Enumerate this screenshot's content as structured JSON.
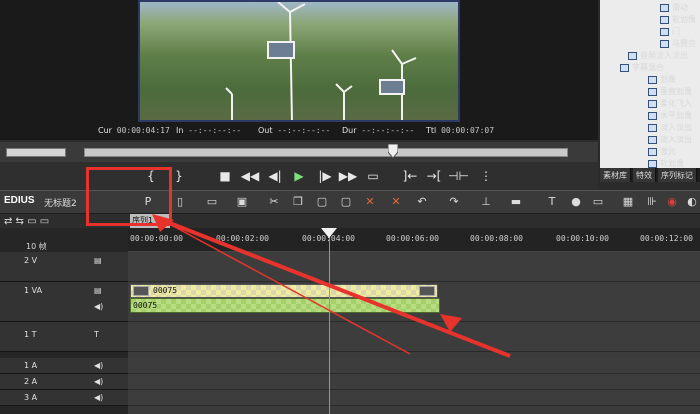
{
  "monitor": {
    "timecodes": [
      {
        "label": "Cur",
        "value": "00:00:04:17"
      },
      {
        "label": "In",
        "value": "--:--:--:--"
      },
      {
        "label": "Out",
        "value": "--:--:--:--"
      },
      {
        "label": "Dur",
        "value": "--:--:--:--"
      },
      {
        "label": "Ttl",
        "value": "00:00:07:07"
      }
    ]
  },
  "bin": {
    "items": [
      "滑动",
      "软划像",
      "门",
      "马赛克",
      "音频淡入淡出",
      "字幕混合",
      "划像",
      "垂直划像",
      "柔化飞入",
      "水平划像",
      "淡入淡出",
      "淡入淡出",
      "激光",
      "软划像"
    ],
    "tabs": [
      "素材库",
      "特效",
      "序列标记"
    ]
  },
  "toolbar": {
    "logo": "EDIUS",
    "project": "无标题2"
  },
  "timeline": {
    "sequence_tab": "序列1",
    "scale_label": "10 帧",
    "ruler": [
      "00:00:00:00",
      "00:00:02:00",
      "00:00:04:00",
      "00:00:06:00",
      "00:00:08:00",
      "00:00:10:00",
      "00:00:12:00"
    ],
    "tracks": [
      {
        "name": "2 V",
        "type": "video"
      },
      {
        "name": "1 VA",
        "type": "va"
      },
      {
        "name": "1 T",
        "type": "title"
      },
      {
        "name": "1 A",
        "type": "audio"
      },
      {
        "name": "2 A",
        "type": "audio"
      },
      {
        "name": "3 A",
        "type": "audio"
      }
    ],
    "clips": {
      "video_label": "00075",
      "audio_label": "00075"
    }
  },
  "colors": {
    "accent_annotation": "#e8332c",
    "video_clip": "#f1eaa3",
    "audio_clip": "#a4cf6a",
    "playhead": "#5fa8b8"
  }
}
